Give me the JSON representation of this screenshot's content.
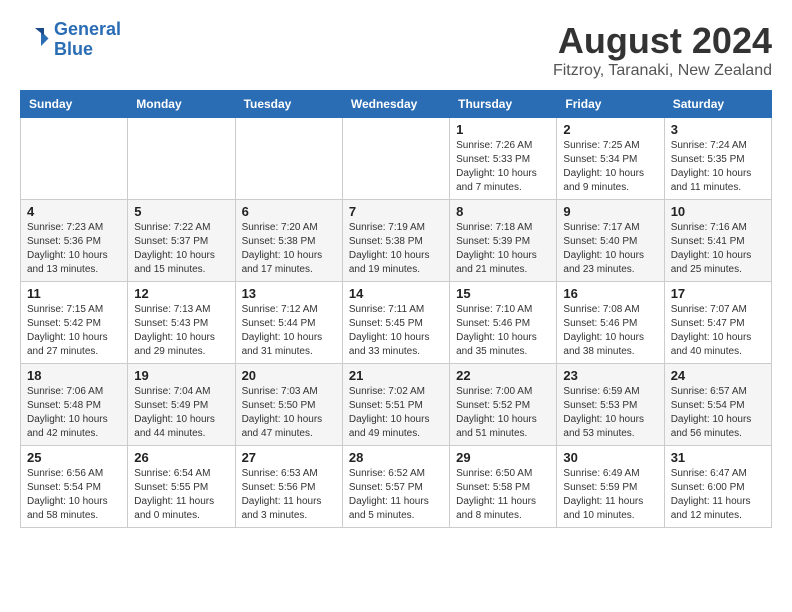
{
  "logo": {
    "line1": "General",
    "line2": "Blue"
  },
  "title": "August 2024",
  "location": "Fitzroy, Taranaki, New Zealand",
  "days_of_week": [
    "Sunday",
    "Monday",
    "Tuesday",
    "Wednesday",
    "Thursday",
    "Friday",
    "Saturday"
  ],
  "weeks": [
    [
      {
        "day": "",
        "info": ""
      },
      {
        "day": "",
        "info": ""
      },
      {
        "day": "",
        "info": ""
      },
      {
        "day": "",
        "info": ""
      },
      {
        "day": "1",
        "info": "Sunrise: 7:26 AM\nSunset: 5:33 PM\nDaylight: 10 hours\nand 7 minutes."
      },
      {
        "day": "2",
        "info": "Sunrise: 7:25 AM\nSunset: 5:34 PM\nDaylight: 10 hours\nand 9 minutes."
      },
      {
        "day": "3",
        "info": "Sunrise: 7:24 AM\nSunset: 5:35 PM\nDaylight: 10 hours\nand 11 minutes."
      }
    ],
    [
      {
        "day": "4",
        "info": "Sunrise: 7:23 AM\nSunset: 5:36 PM\nDaylight: 10 hours\nand 13 minutes."
      },
      {
        "day": "5",
        "info": "Sunrise: 7:22 AM\nSunset: 5:37 PM\nDaylight: 10 hours\nand 15 minutes."
      },
      {
        "day": "6",
        "info": "Sunrise: 7:20 AM\nSunset: 5:38 PM\nDaylight: 10 hours\nand 17 minutes."
      },
      {
        "day": "7",
        "info": "Sunrise: 7:19 AM\nSunset: 5:38 PM\nDaylight: 10 hours\nand 19 minutes."
      },
      {
        "day": "8",
        "info": "Sunrise: 7:18 AM\nSunset: 5:39 PM\nDaylight: 10 hours\nand 21 minutes."
      },
      {
        "day": "9",
        "info": "Sunrise: 7:17 AM\nSunset: 5:40 PM\nDaylight: 10 hours\nand 23 minutes."
      },
      {
        "day": "10",
        "info": "Sunrise: 7:16 AM\nSunset: 5:41 PM\nDaylight: 10 hours\nand 25 minutes."
      }
    ],
    [
      {
        "day": "11",
        "info": "Sunrise: 7:15 AM\nSunset: 5:42 PM\nDaylight: 10 hours\nand 27 minutes."
      },
      {
        "day": "12",
        "info": "Sunrise: 7:13 AM\nSunset: 5:43 PM\nDaylight: 10 hours\nand 29 minutes."
      },
      {
        "day": "13",
        "info": "Sunrise: 7:12 AM\nSunset: 5:44 PM\nDaylight: 10 hours\nand 31 minutes."
      },
      {
        "day": "14",
        "info": "Sunrise: 7:11 AM\nSunset: 5:45 PM\nDaylight: 10 hours\nand 33 minutes."
      },
      {
        "day": "15",
        "info": "Sunrise: 7:10 AM\nSunset: 5:46 PM\nDaylight: 10 hours\nand 35 minutes."
      },
      {
        "day": "16",
        "info": "Sunrise: 7:08 AM\nSunset: 5:46 PM\nDaylight: 10 hours\nand 38 minutes."
      },
      {
        "day": "17",
        "info": "Sunrise: 7:07 AM\nSunset: 5:47 PM\nDaylight: 10 hours\nand 40 minutes."
      }
    ],
    [
      {
        "day": "18",
        "info": "Sunrise: 7:06 AM\nSunset: 5:48 PM\nDaylight: 10 hours\nand 42 minutes."
      },
      {
        "day": "19",
        "info": "Sunrise: 7:04 AM\nSunset: 5:49 PM\nDaylight: 10 hours\nand 44 minutes."
      },
      {
        "day": "20",
        "info": "Sunrise: 7:03 AM\nSunset: 5:50 PM\nDaylight: 10 hours\nand 47 minutes."
      },
      {
        "day": "21",
        "info": "Sunrise: 7:02 AM\nSunset: 5:51 PM\nDaylight: 10 hours\nand 49 minutes."
      },
      {
        "day": "22",
        "info": "Sunrise: 7:00 AM\nSunset: 5:52 PM\nDaylight: 10 hours\nand 51 minutes."
      },
      {
        "day": "23",
        "info": "Sunrise: 6:59 AM\nSunset: 5:53 PM\nDaylight: 10 hours\nand 53 minutes."
      },
      {
        "day": "24",
        "info": "Sunrise: 6:57 AM\nSunset: 5:54 PM\nDaylight: 10 hours\nand 56 minutes."
      }
    ],
    [
      {
        "day": "25",
        "info": "Sunrise: 6:56 AM\nSunset: 5:54 PM\nDaylight: 10 hours\nand 58 minutes."
      },
      {
        "day": "26",
        "info": "Sunrise: 6:54 AM\nSunset: 5:55 PM\nDaylight: 11 hours\nand 0 minutes."
      },
      {
        "day": "27",
        "info": "Sunrise: 6:53 AM\nSunset: 5:56 PM\nDaylight: 11 hours\nand 3 minutes."
      },
      {
        "day": "28",
        "info": "Sunrise: 6:52 AM\nSunset: 5:57 PM\nDaylight: 11 hours\nand 5 minutes."
      },
      {
        "day": "29",
        "info": "Sunrise: 6:50 AM\nSunset: 5:58 PM\nDaylight: 11 hours\nand 8 minutes."
      },
      {
        "day": "30",
        "info": "Sunrise: 6:49 AM\nSunset: 5:59 PM\nDaylight: 11 hours\nand 10 minutes."
      },
      {
        "day": "31",
        "info": "Sunrise: 6:47 AM\nSunset: 6:00 PM\nDaylight: 11 hours\nand 12 minutes."
      }
    ]
  ]
}
